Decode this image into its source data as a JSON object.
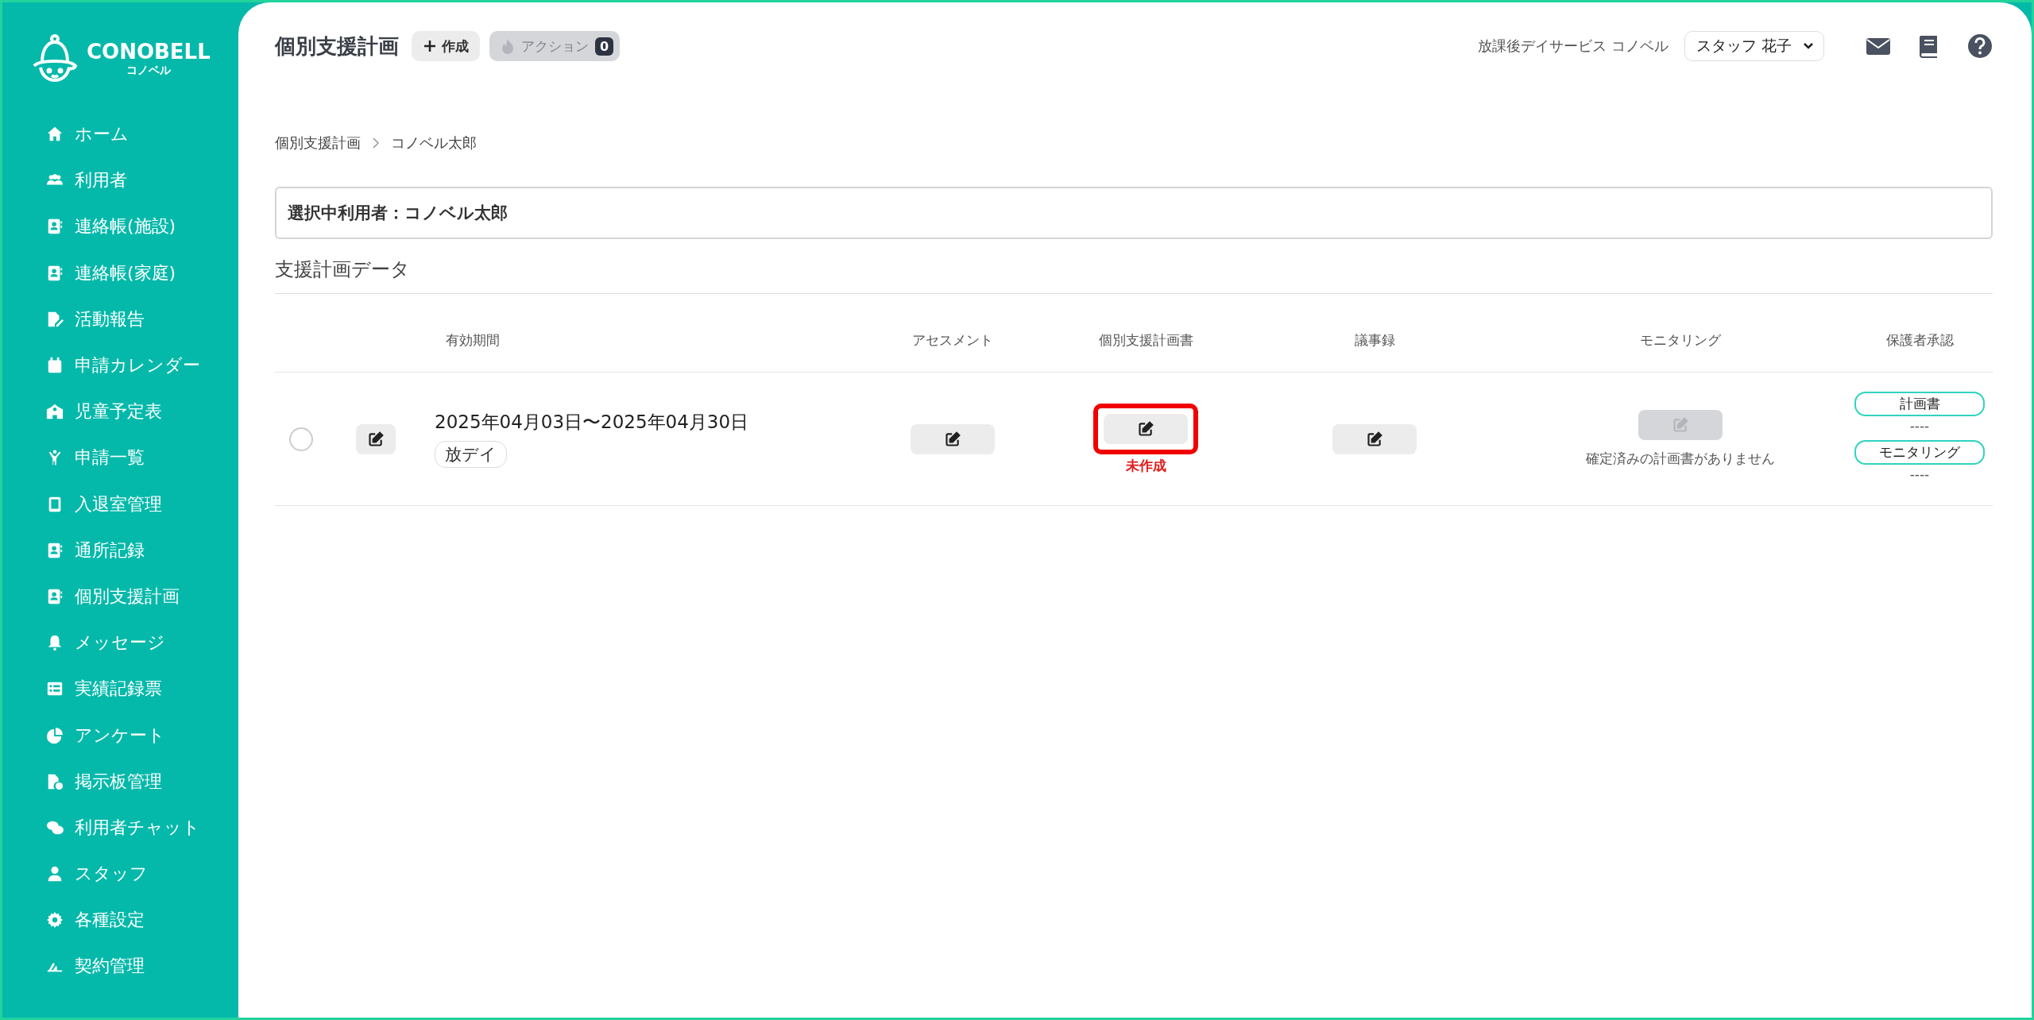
{
  "logo": {
    "wordmark": "CONOBELL",
    "subtitle": "コノベル"
  },
  "sidebar": {
    "items": [
      {
        "label": "ホーム"
      },
      {
        "label": "利用者"
      },
      {
        "label": "連絡帳(施設)"
      },
      {
        "label": "連絡帳(家庭)"
      },
      {
        "label": "活動報告"
      },
      {
        "label": "申請カレンダー"
      },
      {
        "label": "児童予定表"
      },
      {
        "label": "申請一覧"
      },
      {
        "label": "入退室管理"
      },
      {
        "label": "通所記録"
      },
      {
        "label": "個別支援計画"
      },
      {
        "label": "メッセージ"
      },
      {
        "label": "実績記録票"
      },
      {
        "label": "アンケート"
      },
      {
        "label": "掲示板管理"
      },
      {
        "label": "利用者チャット"
      },
      {
        "label": "スタッフ"
      },
      {
        "label": "各種設定"
      },
      {
        "label": "契約管理"
      }
    ]
  },
  "header": {
    "title": "個別支援計画",
    "create_button": {
      "label": "作成"
    },
    "action_button": {
      "label": "アクション",
      "count": "0",
      "disabled": true
    },
    "facility": "放課後デイサービス コノベル",
    "staff_select": {
      "value": "スタッフ 花子"
    }
  },
  "breadcrumb": [
    "個別支援計画",
    "コノベル太郎"
  ],
  "selected_user": "選択中利用者：コノベル太郎",
  "section_title": "支援計画データ",
  "table": {
    "columns": [
      "有効期間",
      "アセスメント",
      "個別支援計画書",
      "議事録",
      "モニタリング",
      "保護者承認"
    ],
    "rows": [
      {
        "checked": false,
        "period": "2025年04月03日〜2025年04月30日",
        "tag": "放デイ",
        "assessment": {
          "disabled": false
        },
        "plan": {
          "disabled": false,
          "highlighted": true,
          "status": "未作成"
        },
        "minutes": {
          "disabled": false
        },
        "monitoring": {
          "disabled": true,
          "note": "確定済みの計画書がありません"
        },
        "approvals": [
          {
            "label": "計画書",
            "value": "----"
          },
          {
            "label": "モニタリング",
            "value": "----"
          }
        ]
      }
    ]
  }
}
